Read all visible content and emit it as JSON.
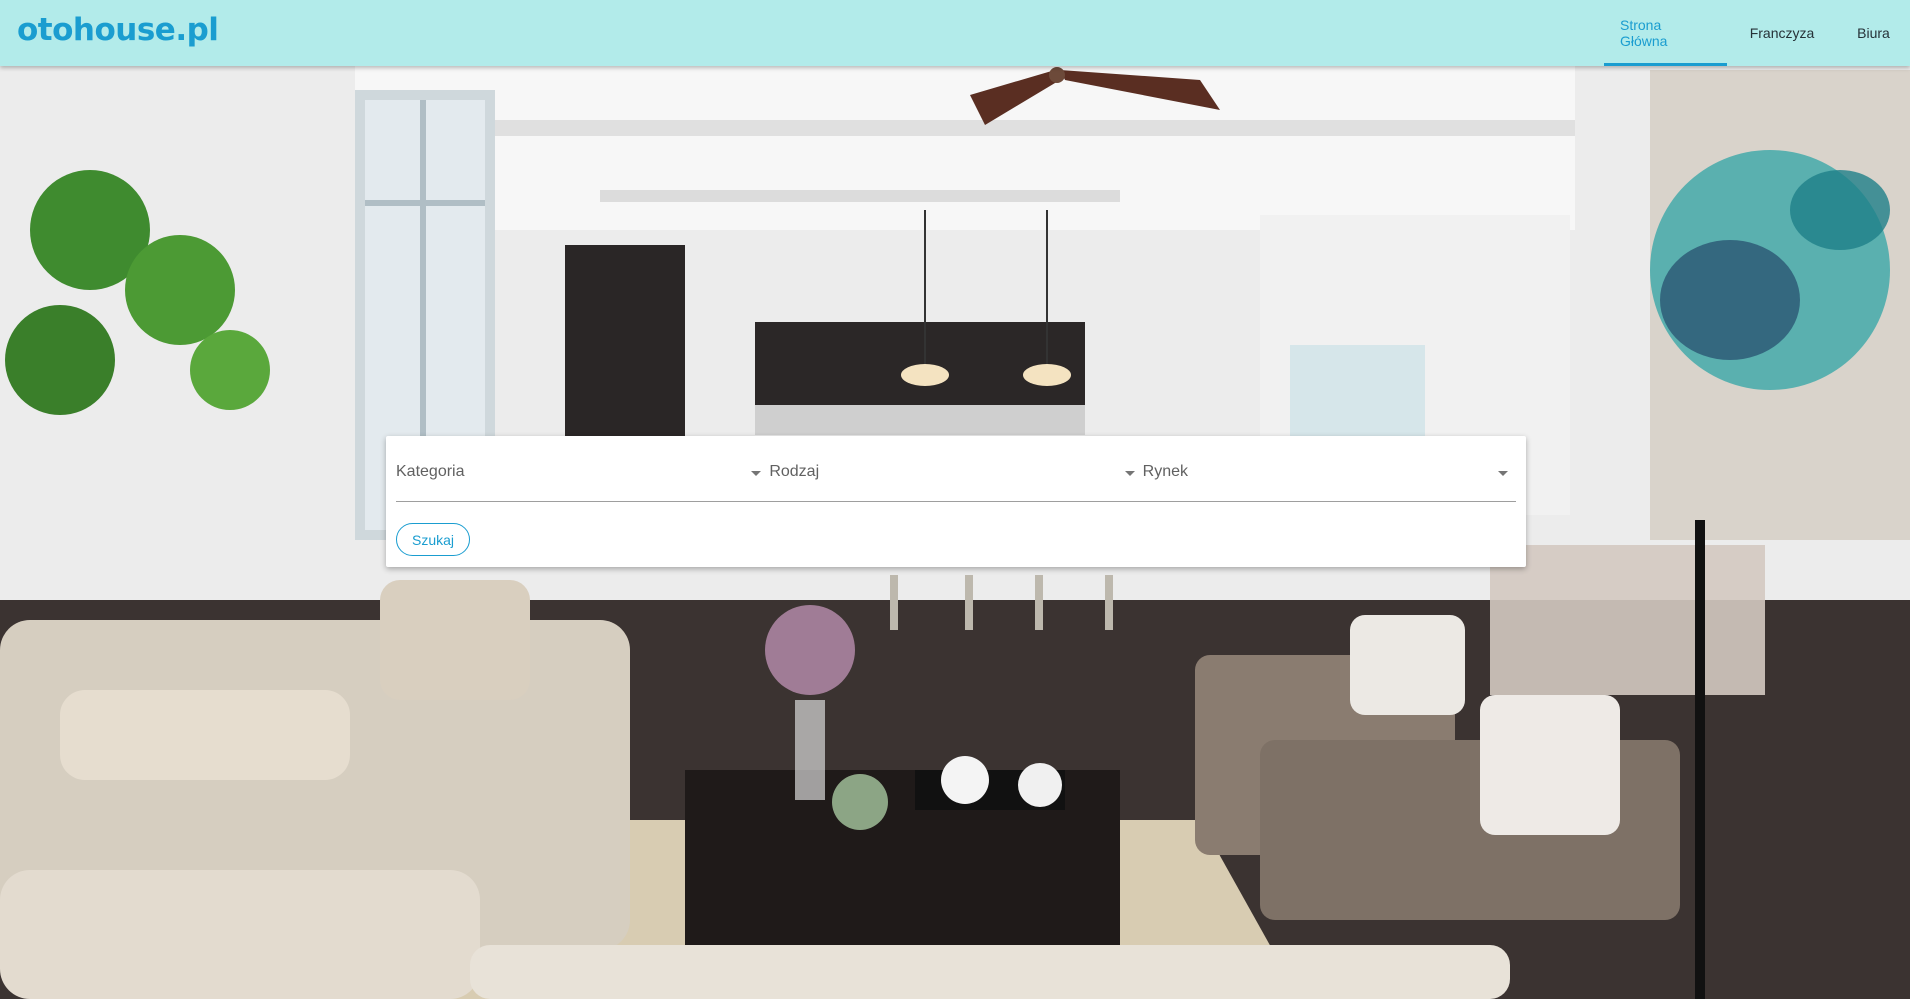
{
  "header": {
    "logo": "otohouse.pl",
    "nav": [
      {
        "label": "Strona Główna",
        "active": true
      },
      {
        "label": "Franczyza",
        "active": false
      },
      {
        "label": "Biura",
        "active": false
      }
    ]
  },
  "search": {
    "selects": [
      {
        "label": "Kategoria"
      },
      {
        "label": "Rodzaj"
      },
      {
        "label": "Rynek"
      }
    ],
    "button_label": "Szukaj"
  },
  "colors": {
    "header_bg": "#b2ebea",
    "accent": "#1a9dd0"
  }
}
